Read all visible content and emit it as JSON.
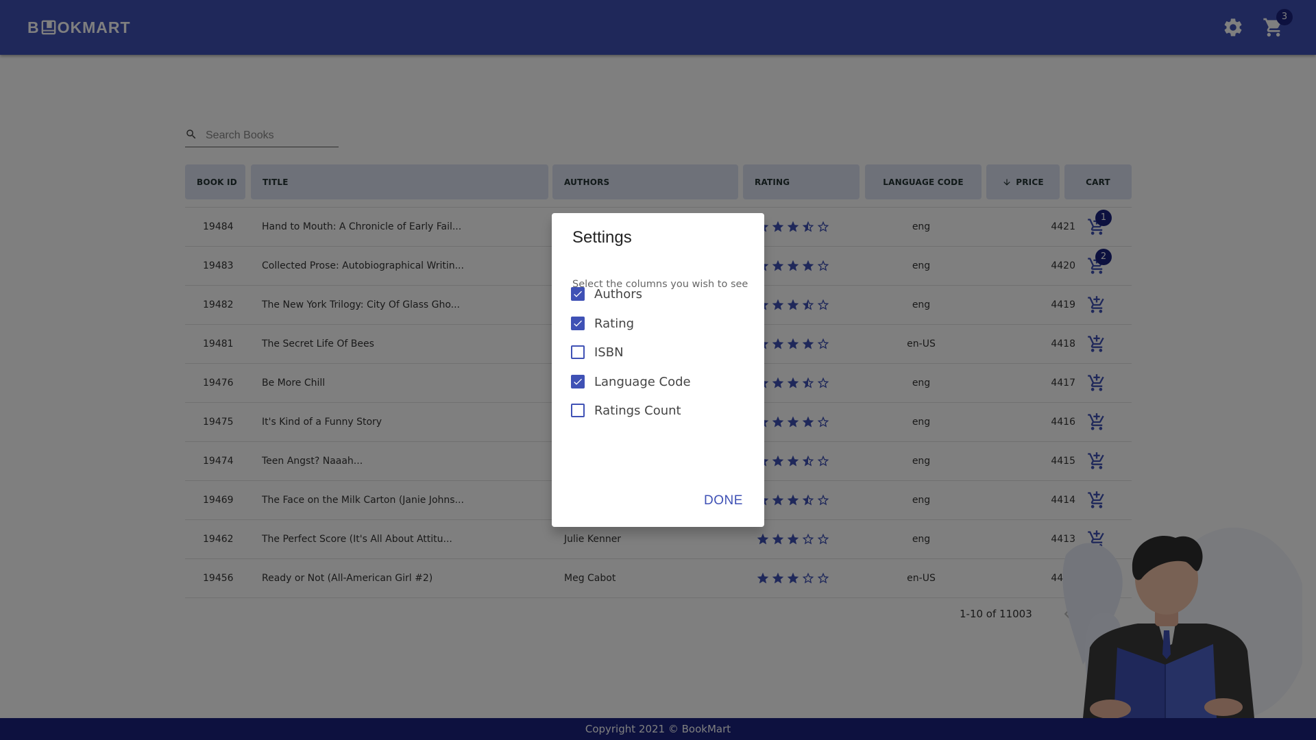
{
  "header": {
    "logo_text_left": "B",
    "logo_text_right": "OKMART",
    "cart_count": "3"
  },
  "search": {
    "placeholder": "Search Books"
  },
  "table": {
    "columns": {
      "book_id": "BOOK ID",
      "title": "TITLE",
      "authors": "AUTHORS",
      "rating": "RATING",
      "language_code": "LANGUAGE CODE",
      "price": "PRICE",
      "cart": "CART"
    },
    "rows": [
      {
        "id": "19484",
        "title": "Hand to Mouth: A Chronicle of Early Fail...",
        "author": "",
        "rating": 3.5,
        "lang": "eng",
        "price": "4421",
        "cart_count": "1"
      },
      {
        "id": "19483",
        "title": "Collected Prose: Autobiographical Writin...",
        "author": "",
        "rating": 4,
        "lang": "eng",
        "price": "4420",
        "cart_count": "2"
      },
      {
        "id": "19482",
        "title": "The New York Trilogy: City Of Glass Gho...",
        "author": "",
        "rating": 3.5,
        "lang": "eng",
        "price": "4419",
        "cart_count": ""
      },
      {
        "id": "19481",
        "title": "The Secret Life Of Bees",
        "author": "",
        "rating": 4,
        "lang": "en-US",
        "price": "4418",
        "cart_count": ""
      },
      {
        "id": "19476",
        "title": "Be More Chill",
        "author": "",
        "rating": 3.5,
        "lang": "eng",
        "price": "4417",
        "cart_count": ""
      },
      {
        "id": "19475",
        "title": "It's Kind of a Funny Story",
        "author": "",
        "rating": 4,
        "lang": "eng",
        "price": "4416",
        "cart_count": ""
      },
      {
        "id": "19474",
        "title": "Teen Angst? Naaah...",
        "author": "",
        "rating": 3.5,
        "lang": "eng",
        "price": "4415",
        "cart_count": ""
      },
      {
        "id": "19469",
        "title": "The Face on the Milk Carton (Janie Johns...",
        "author": "",
        "rating": 3.5,
        "lang": "eng",
        "price": "4414",
        "cart_count": ""
      },
      {
        "id": "19462",
        "title": "The Perfect Score (It's All About Attitu...",
        "author": "Julie Kenner",
        "rating": 3,
        "lang": "eng",
        "price": "4413",
        "cart_count": ""
      },
      {
        "id": "19456",
        "title": "Ready or Not (All-American Girl #2)",
        "author": "Meg Cabot",
        "rating": 3,
        "lang": "en-US",
        "price": "4412",
        "cart_count": ""
      }
    ]
  },
  "pagination": {
    "range_text": "1-10 of 11003"
  },
  "footer": {
    "text": "Copyright 2021 © BookMart"
  },
  "dialog": {
    "title": "Settings",
    "description": "Select the columns you wish to see",
    "options": [
      {
        "label": "Authors",
        "checked": true
      },
      {
        "label": "Rating",
        "checked": true
      },
      {
        "label": "ISBN",
        "checked": false
      },
      {
        "label": "Language Code",
        "checked": true
      },
      {
        "label": "Ratings Count",
        "checked": false
      }
    ],
    "done_label": "DONE"
  },
  "colors": {
    "primary": "#3f51b5",
    "dark_primary": "#1a237e",
    "header_cell": "#dde2f3",
    "backdrop": "rgba(0,0,0,0.5)"
  }
}
